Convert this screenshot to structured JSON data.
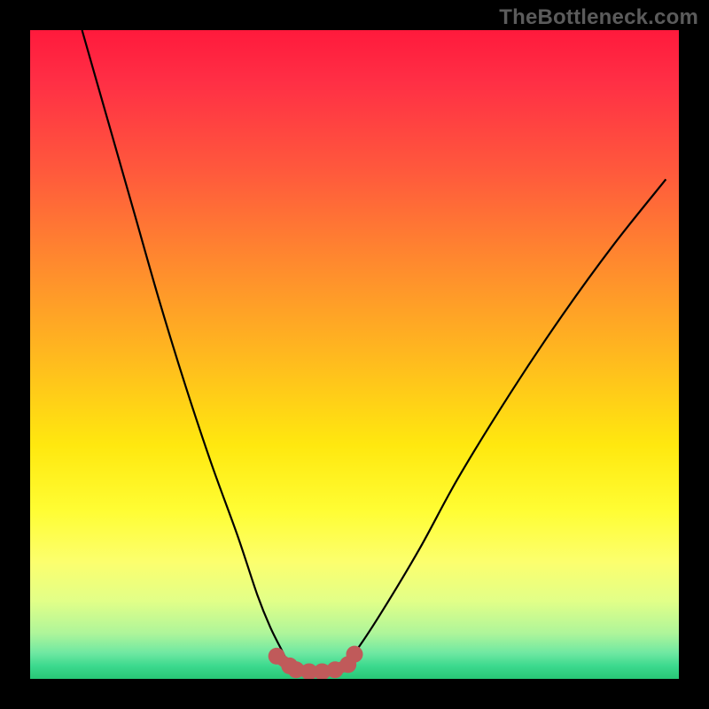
{
  "watermark": "TheBottleneck.com",
  "chart_data": {
    "type": "line",
    "title": "",
    "xlabel": "",
    "ylabel": "",
    "xlim": [
      0,
      100
    ],
    "ylim": [
      0,
      100
    ],
    "series": [
      {
        "name": "bottleneck-curve",
        "x": [
          8,
          12,
          16,
          20,
          24,
          28,
          32,
          35,
          37,
          39,
          40,
          42,
          44,
          46,
          48,
          50,
          54,
          60,
          66,
          74,
          82,
          90,
          98
        ],
        "y": [
          100,
          86,
          72,
          58,
          45,
          33,
          22,
          13,
          8,
          4,
          2,
          1,
          1,
          1,
          2,
          4,
          10,
          20,
          31,
          44,
          56,
          67,
          77
        ]
      }
    ],
    "highlight": {
      "name": "optimal-range-markers",
      "x": [
        38,
        40,
        41,
        43,
        45,
        47,
        49,
        50
      ],
      "y": [
        3.5,
        2.0,
        1.4,
        1.1,
        1.1,
        1.4,
        2.2,
        3.8
      ]
    },
    "colors": {
      "curve": "#000000",
      "markers": "#c05a5a",
      "background_top": "#ff1a3c",
      "background_bottom": "#28c776"
    }
  }
}
